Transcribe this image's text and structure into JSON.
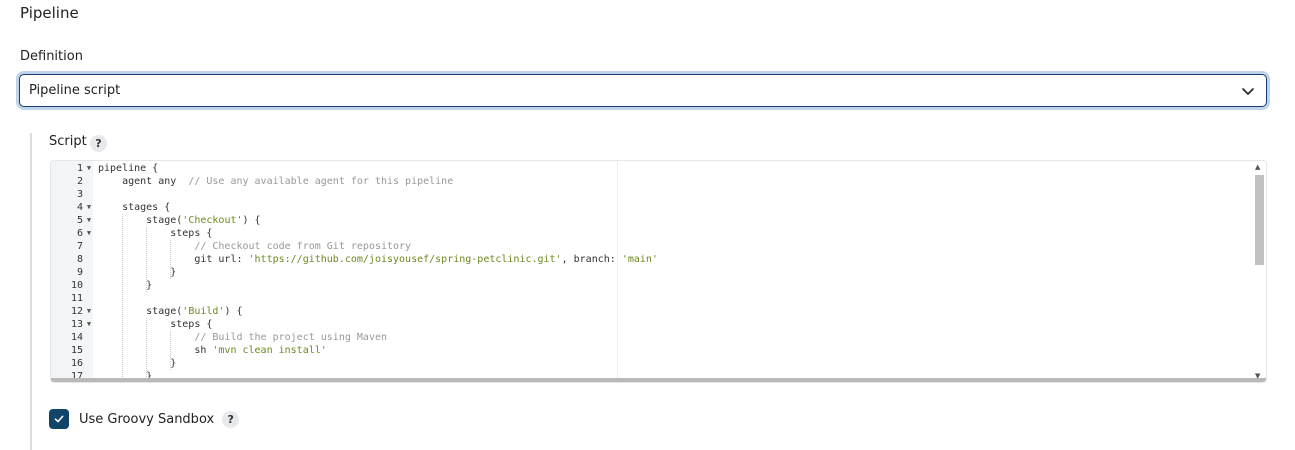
{
  "section": {
    "title": "Pipeline"
  },
  "definition": {
    "label": "Definition",
    "selected": "Pipeline script"
  },
  "script": {
    "label": "Script",
    "help": "?",
    "lines": [
      {
        "n": "1",
        "fold": true,
        "text": "pipeline {"
      },
      {
        "n": "2",
        "fold": false,
        "text": "    agent any  ",
        "comment": "// Use any available agent for this pipeline"
      },
      {
        "n": "3",
        "fold": false,
        "text": ""
      },
      {
        "n": "4",
        "fold": true,
        "text": "    stages {"
      },
      {
        "n": "5",
        "fold": true,
        "text": "        stage(",
        "str": "'Checkout'",
        "tail": ") {"
      },
      {
        "n": "6",
        "fold": true,
        "text": "            steps {"
      },
      {
        "n": "7",
        "fold": false,
        "text": "                ",
        "comment": "// Checkout code from Git repository"
      },
      {
        "n": "8",
        "fold": false,
        "text": "                git url: ",
        "str": "'https://github.com/joisyousef/spring-petclinic.git'",
        "tail": ", branch: ",
        "str2": "'main'"
      },
      {
        "n": "9",
        "fold": false,
        "text": "            }"
      },
      {
        "n": "10",
        "fold": false,
        "text": "        }"
      },
      {
        "n": "11",
        "fold": false,
        "text": ""
      },
      {
        "n": "12",
        "fold": true,
        "text": "        stage(",
        "str": "'Build'",
        "tail": ") {"
      },
      {
        "n": "13",
        "fold": true,
        "text": "            steps {"
      },
      {
        "n": "14",
        "fold": false,
        "text": "                ",
        "comment": "// Build the project using Maven"
      },
      {
        "n": "15",
        "fold": false,
        "text": "                sh ",
        "str": "'mvn clean install'"
      },
      {
        "n": "16",
        "fold": false,
        "text": "            }"
      },
      {
        "n": "17",
        "fold": false,
        "text": "        }"
      }
    ]
  },
  "sandbox": {
    "label": "Use Groovy Sandbox",
    "checked": true,
    "help": "?"
  },
  "colors": {
    "accent": "#0f4568",
    "focus_ring": "#bfd3ea",
    "string": "#6a8a1e",
    "comment": "#999999"
  },
  "icons": {
    "dropdown": "chevron-down-icon",
    "check": "check-icon",
    "fold": "fold-arrow-icon"
  }
}
